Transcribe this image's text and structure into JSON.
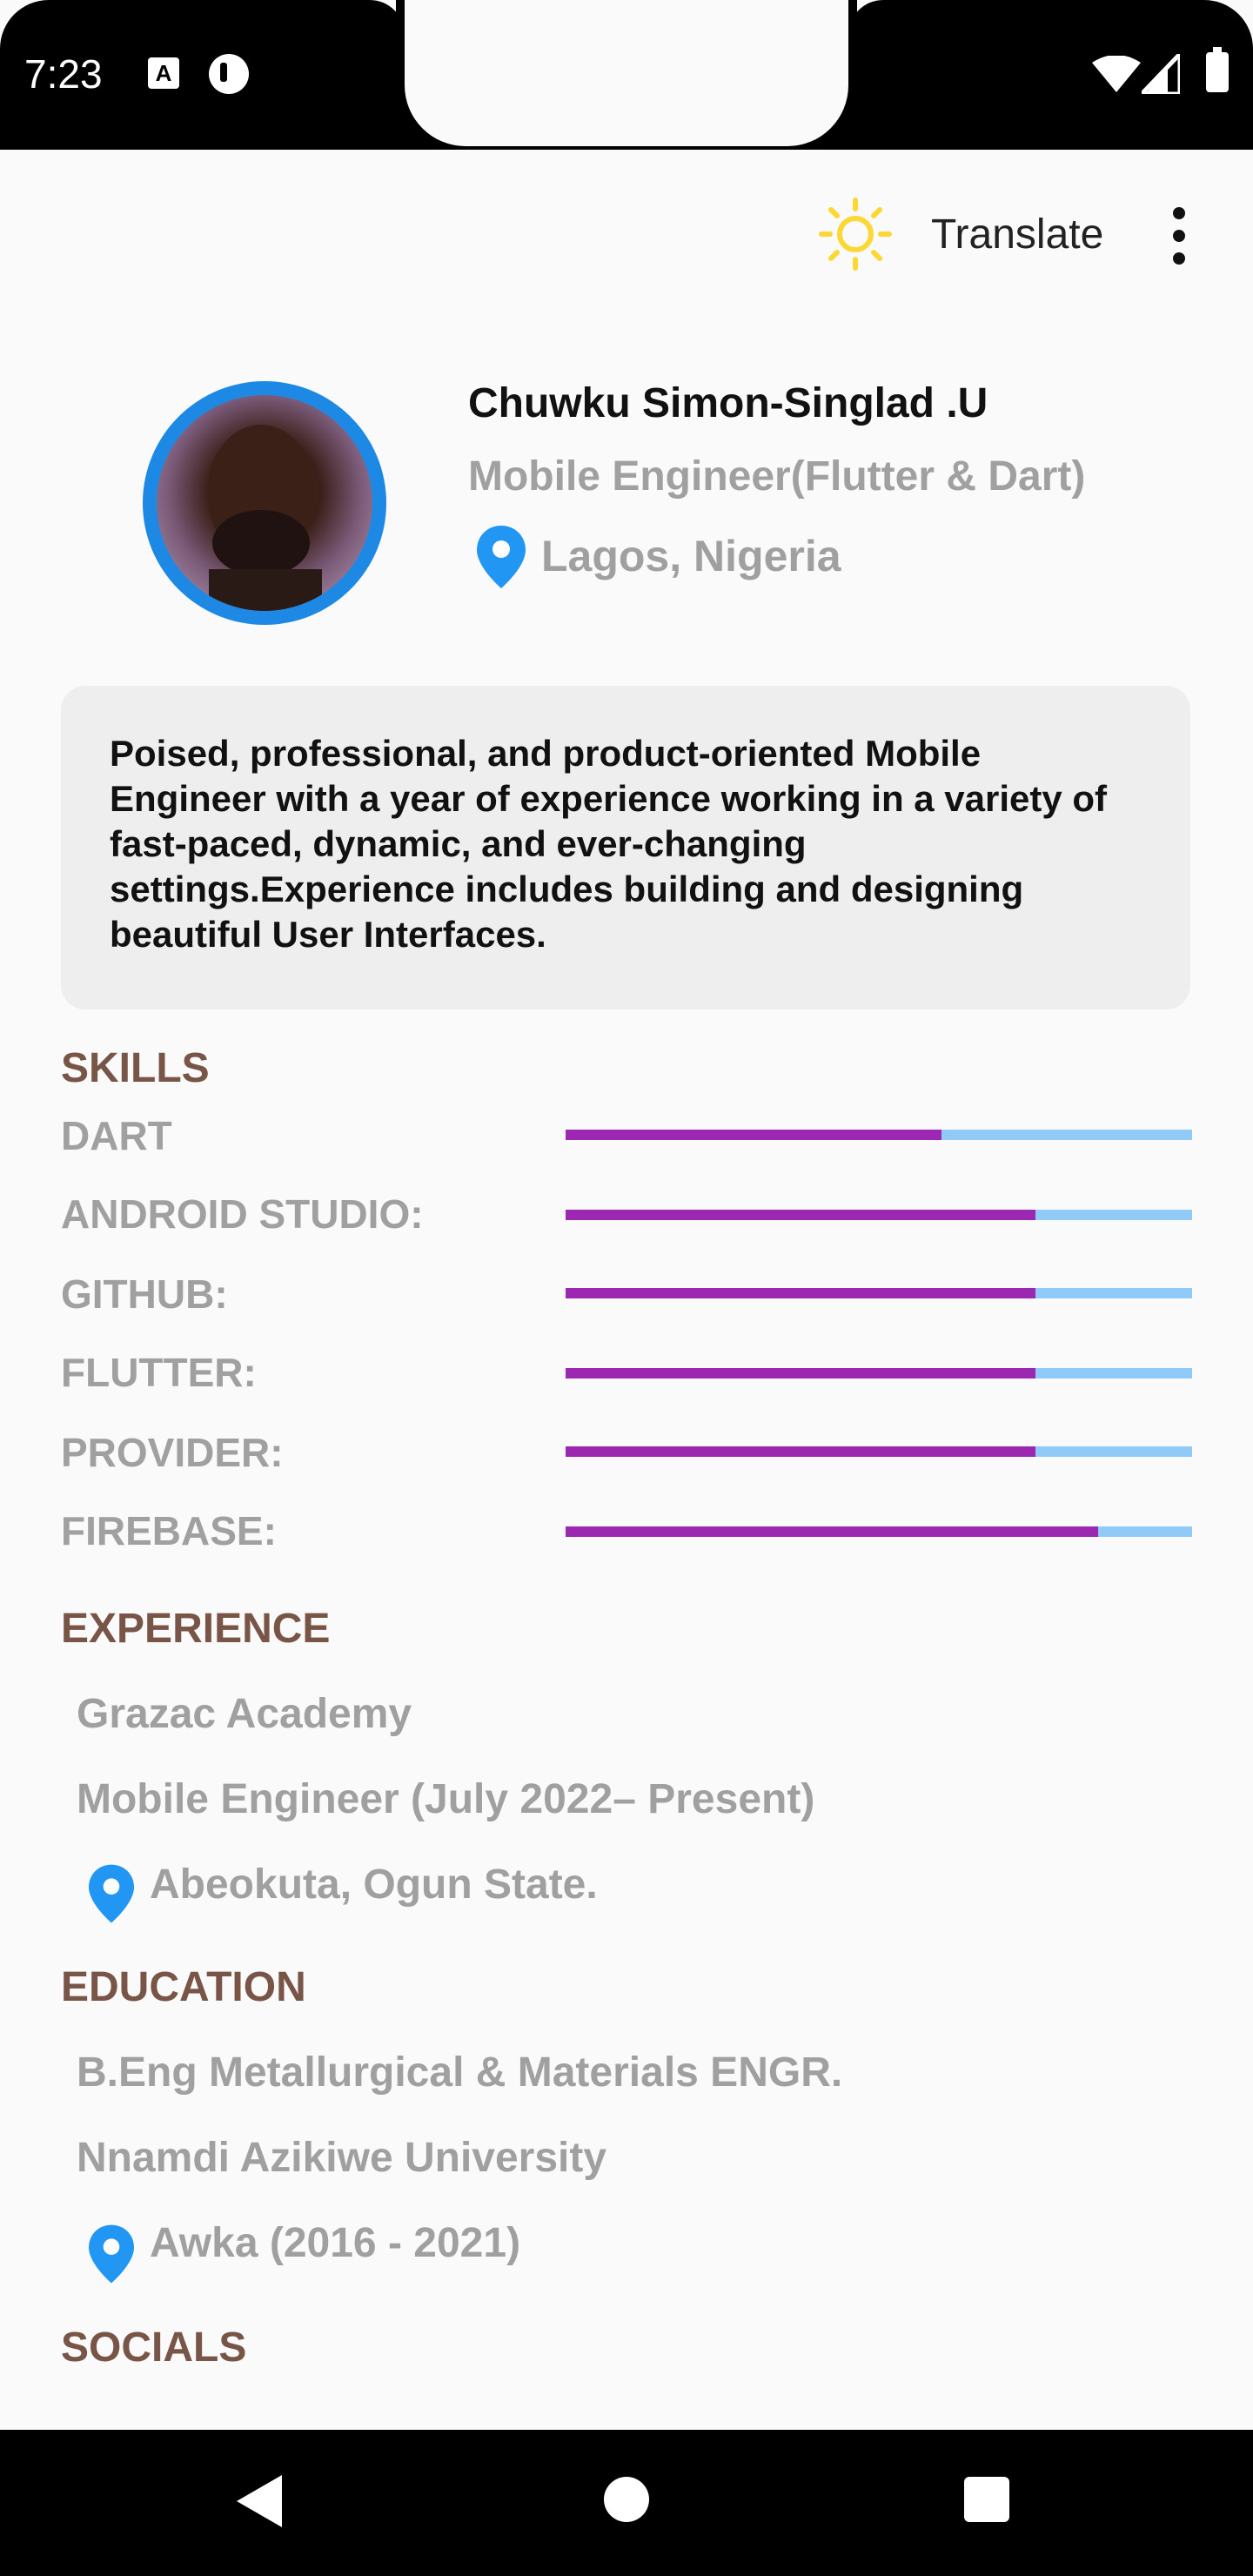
{
  "status_bar": {
    "time": "7:23",
    "notification_icon_letter": "A"
  },
  "toolbar": {
    "theme_icon": "sun-icon",
    "translate_label": "Translate",
    "more_icon": "more-vert-icon"
  },
  "profile": {
    "name": "Chuwku Simon-Singlad .U",
    "role": "Mobile Engineer(Flutter & Dart)",
    "location": "Lagos, Nigeria"
  },
  "bio": "Poised, professional, and product-oriented Mobile Engineer with a year of experience working in a variety of fast-paced, dynamic, and ever-changing settings.Experience includes building and designing beautiful User Interfaces.",
  "skills": {
    "title": "SKILLS",
    "items": [
      {
        "label": "DART",
        "level": 0.6
      },
      {
        "label": "ANDROID STUDIO:",
        "level": 0.75
      },
      {
        "label": "GITHUB:",
        "level": 0.75
      },
      {
        "label": "FLUTTER:",
        "level": 0.75
      },
      {
        "label": "PROVIDER:",
        "level": 0.75
      },
      {
        "label": "FIREBASE:",
        "level": 0.85
      }
    ]
  },
  "experience": {
    "title": "EXPERIENCE",
    "company": "Grazac Academy",
    "position": "Mobile Engineer (July 2022– Present)",
    "location": "Abeokuta, Ogun State."
  },
  "education": {
    "title": "EDUCATION",
    "degree": "B.Eng Metallurgical & Materials ENGR.",
    "school": "Nnamdi Azikiwe University",
    "location": "Awka (2016 - 2021)"
  },
  "socials": {
    "title": "SOCIALS"
  },
  "colors": {
    "accent_blue": "#1e88e5",
    "section_title": "#795548",
    "skill_fill": "#9c27b0",
    "skill_track": "#90caf9",
    "sun": "#fdd835"
  }
}
